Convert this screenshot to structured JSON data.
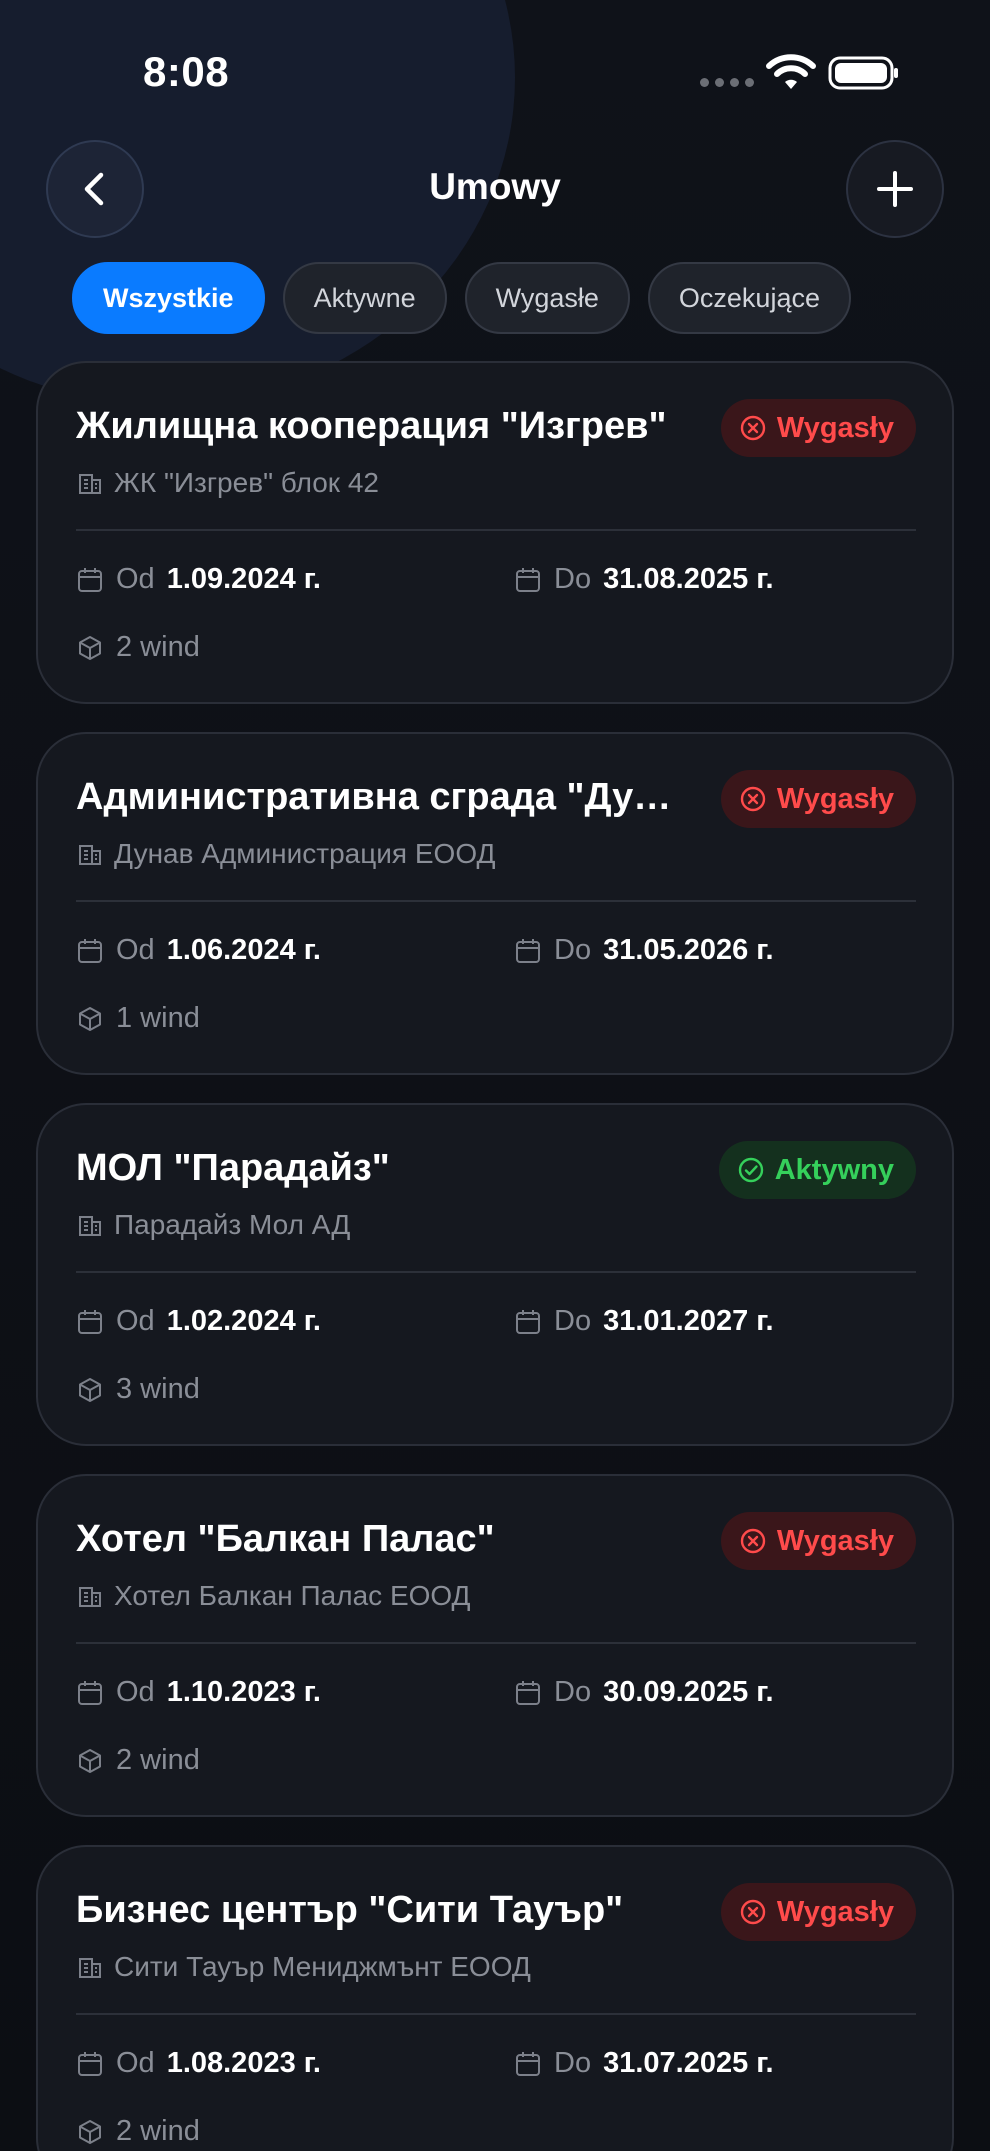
{
  "status_bar": {
    "time": "8:08"
  },
  "header": {
    "title": "Umowy"
  },
  "tabs": [
    {
      "label": "Wszystkie",
      "active": true
    },
    {
      "label": "Aktywne",
      "active": false
    },
    {
      "label": "Wygasłe",
      "active": false
    },
    {
      "label": "Oczekujące",
      "active": false
    }
  ],
  "labels": {
    "from": "Od",
    "to": "Do"
  },
  "contracts": [
    {
      "title": "Жилищна кооперация \"Изгрев\"",
      "company": "ЖК \"Изгрев\" блок 42",
      "status": "Wygasły",
      "status_type": "expired",
      "from": "1.09.2024 г.",
      "to": "31.08.2025 г.",
      "units": "2 wind"
    },
    {
      "title": "Административна сграда \"Дунав\"",
      "company": "Дунав Администрация ЕООД",
      "status": "Wygasły",
      "status_type": "expired",
      "from": "1.06.2024 г.",
      "to": "31.05.2026 г.",
      "units": "1 wind"
    },
    {
      "title": "МОЛ \"Парадайз\"",
      "company": "Парадайз Мол АД",
      "status": "Aktywny",
      "status_type": "active",
      "from": "1.02.2024 г.",
      "to": "31.01.2027 г.",
      "units": "3 wind"
    },
    {
      "title": "Хотел \"Балкан Палас\"",
      "company": "Хотел Балкан Палас ЕООД",
      "status": "Wygasły",
      "status_type": "expired",
      "from": "1.10.2023 г.",
      "to": "30.09.2025 г.",
      "units": "2 wind"
    },
    {
      "title": "Бизнес център \"Сити Тауър\"",
      "company": "Сити Тауър Мениджмънт ЕООД",
      "status": "Wygasły",
      "status_type": "expired",
      "from": "1.08.2023 г.",
      "to": "31.07.2025 г.",
      "units": "2 wind"
    }
  ],
  "colors": {
    "accent": "#0a7bff",
    "expired": "#ff4b4b",
    "active": "#35d05b"
  }
}
